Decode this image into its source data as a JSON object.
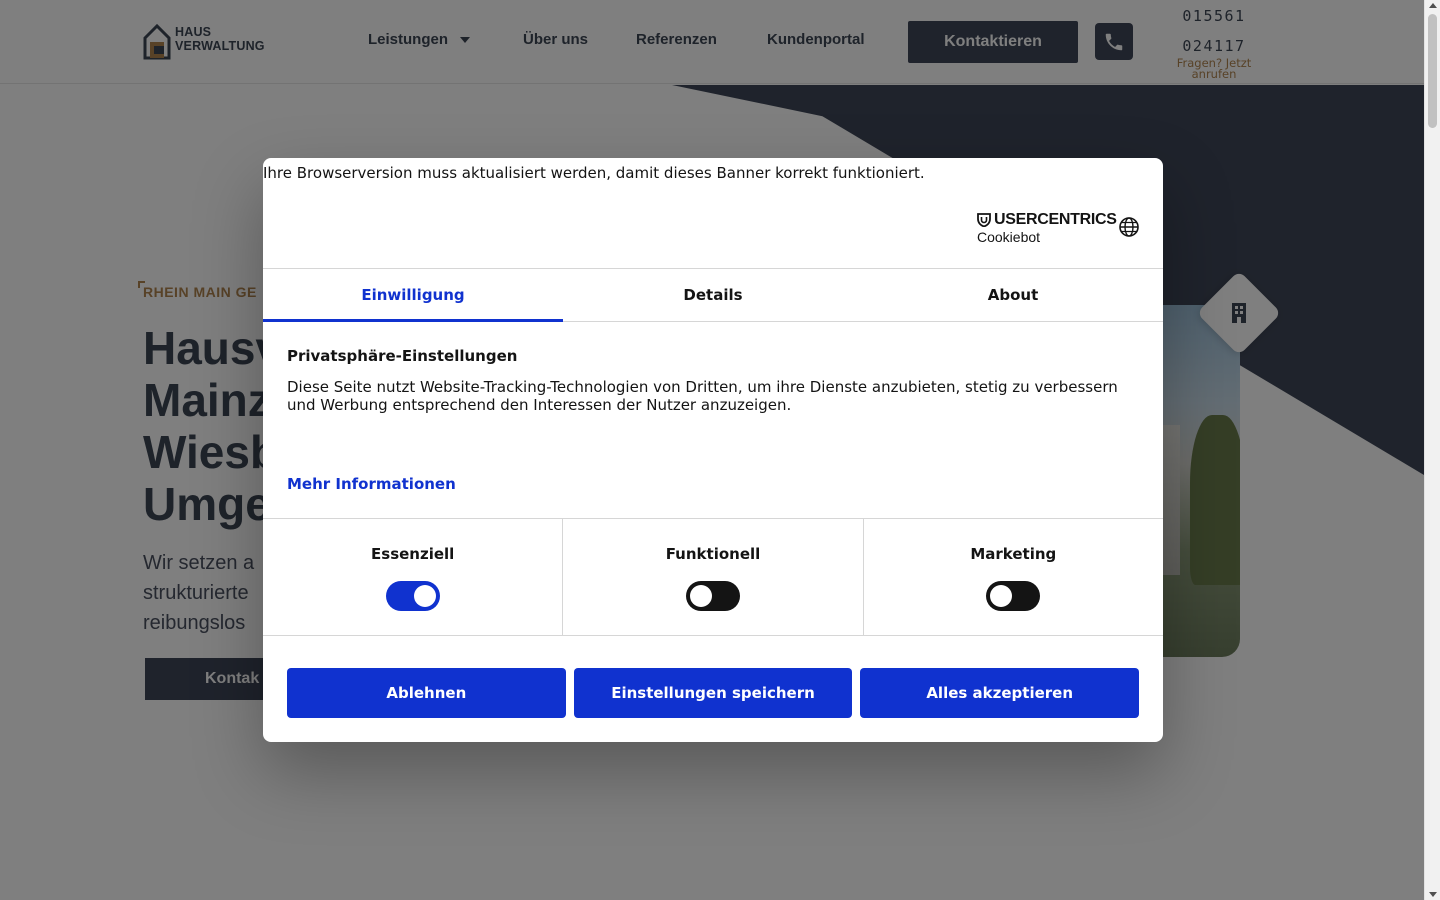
{
  "header": {
    "logo_line1": "HAUS",
    "logo_line2": "VERWALTUNG",
    "nav": [
      {
        "label": "Leistungen"
      },
      {
        "label": "Über uns"
      },
      {
        "label": "Referenzen"
      },
      {
        "label": "Kundenportal"
      }
    ],
    "contact_button": "Kontaktieren",
    "phone_line1": "015561",
    "phone_line2": "024117",
    "phone_sub_line1": "Fragen? Jetzt",
    "phone_sub_line2": "anrufen"
  },
  "hero": {
    "eyebrow": "RHEIN MAIN GE",
    "title_lines": [
      "Hausv",
      "Mainz",
      "Wiesb",
      "Umge"
    ],
    "subtitle_lines": [
      "Wir setzen a",
      "strukturierte",
      "reibungslos"
    ],
    "button": "Kontak"
  },
  "consent": {
    "notice": "Ihre Browserversion muss aktualisiert werden, damit dieses Banner korrekt funktioniert.",
    "brand_top": "USERCENTRICS",
    "brand_bottom": "Cookiebot",
    "tabs": [
      {
        "label": "Einwilligung",
        "active": true
      },
      {
        "label": "Details",
        "active": false
      },
      {
        "label": "About",
        "active": false
      }
    ],
    "section_title": "Privatsphäre-Einstellungen",
    "section_body": "Diese Seite nutzt Website-Tracking-Technologien von Dritten, um ihre Dienste anzubieten, stetig zu verbessern und Werbung entsprechend den Interessen der Nutzer anzuzeigen.",
    "more_info": "Mehr Informationen",
    "toggles": [
      {
        "label": "Essenziell",
        "on": true
      },
      {
        "label": "Funktionell",
        "on": false
      },
      {
        "label": "Marketing",
        "on": false
      }
    ],
    "buttons": {
      "decline": "Ablehnen",
      "save": "Einstellungen speichern",
      "accept_all": "Alles akzeptieren"
    }
  },
  "colors": {
    "accent": "#1032cf",
    "brand_dark": "#3f4758",
    "brand_gold": "#b0844f"
  }
}
